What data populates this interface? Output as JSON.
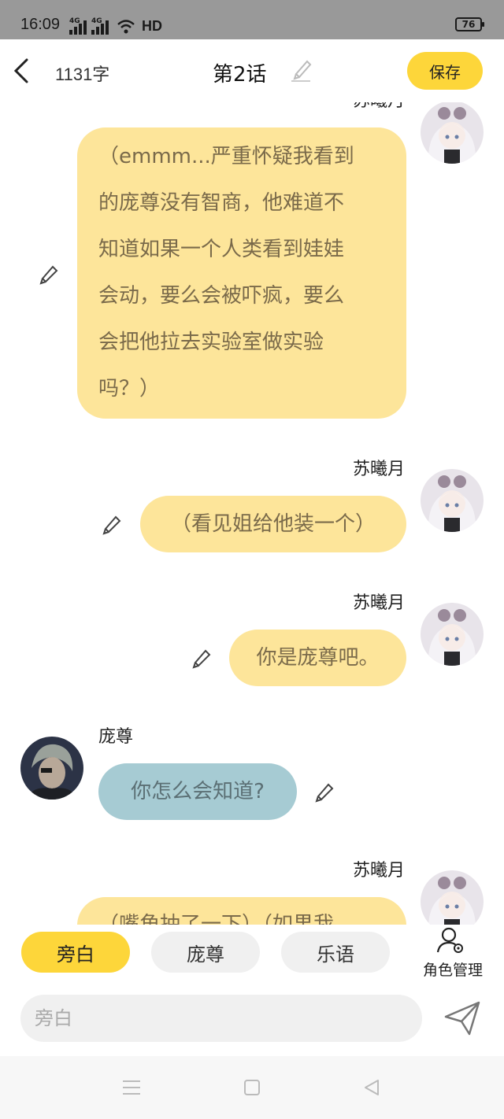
{
  "status_bar": {
    "time": "16:09",
    "network1": "4G",
    "network2": "4G",
    "hd": "HD",
    "battery": "76"
  },
  "header": {
    "word_count": "1131字",
    "title": "第2话",
    "save_label": "保存"
  },
  "messages": [
    {
      "speaker": "苏曦月",
      "text_lines": [
        "（emmm...严重怀疑我看到",
        "的庞尊没有智商，他难道不",
        "知道如果一个人类看到娃娃",
        "会动，要么会被吓疯，要么",
        "会把他拉去实验室做实验",
        "吗？）"
      ]
    },
    {
      "speaker": "苏曦月",
      "text": "（看见姐给他装一个）"
    },
    {
      "speaker": "苏曦月",
      "text": "你是庞尊吧。"
    },
    {
      "speaker": "庞尊",
      "text": "你怎么会知道?"
    },
    {
      "speaker": "苏曦月",
      "text": "（嘴角抽了一下）（如果我"
    }
  ],
  "roles": [
    "旁白",
    "庞尊",
    "乐语"
  ],
  "role_manage_label": "角色管理",
  "input": {
    "placeholder": "旁白"
  },
  "colors": {
    "accent": "#fdd63a",
    "bubble_self": "#fde59a",
    "bubble_other": "#a6cbd3"
  }
}
